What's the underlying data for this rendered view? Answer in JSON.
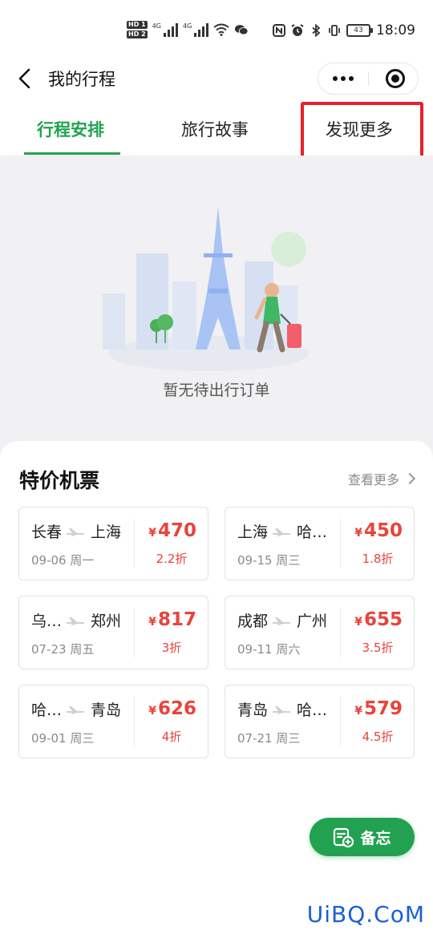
{
  "status_bar": {
    "hd1": "HD 1",
    "hd2": "HD 2",
    "net1": "4G",
    "net2": "4G",
    "battery": "43",
    "time": "18:09"
  },
  "header": {
    "title": "我的行程"
  },
  "tabs": [
    {
      "label": "行程安排",
      "active": true
    },
    {
      "label": "旅行故事",
      "active": false
    },
    {
      "label": "发现更多",
      "active": false
    }
  ],
  "empty_state": {
    "message": "暂无待出行订单"
  },
  "deals": {
    "title": "特价机票",
    "see_more": "查看更多",
    "tickets": [
      {
        "from": "长春",
        "to": "上海",
        "date": "09-06 周一",
        "currency": "¥",
        "price": "470",
        "discount": "2.2折"
      },
      {
        "from": "上海",
        "to": "哈…",
        "date": "09-15 周三",
        "currency": "¥",
        "price": "450",
        "discount": "1.8折"
      },
      {
        "from": "乌…",
        "to": "郑州",
        "date": "07-23 周五",
        "currency": "¥",
        "price": "817",
        "discount": "3折"
      },
      {
        "from": "成都",
        "to": "广州",
        "date": "09-11 周六",
        "currency": "¥",
        "price": "655",
        "discount": "3.5折"
      },
      {
        "from": "哈…",
        "to": "青岛",
        "date": "09-01 周三",
        "currency": "¥",
        "price": "626",
        "discount": "4折"
      },
      {
        "from": "青岛",
        "to": "哈…",
        "date": "07-21 周三",
        "currency": "¥",
        "price": "579",
        "discount": "4.5折"
      }
    ]
  },
  "memo_button": {
    "label": "备忘"
  },
  "watermark": "UiBQ.CoM",
  "colors": {
    "accent_green": "#22a250",
    "price_red": "#e8443a",
    "highlight_red": "#e8202a"
  }
}
